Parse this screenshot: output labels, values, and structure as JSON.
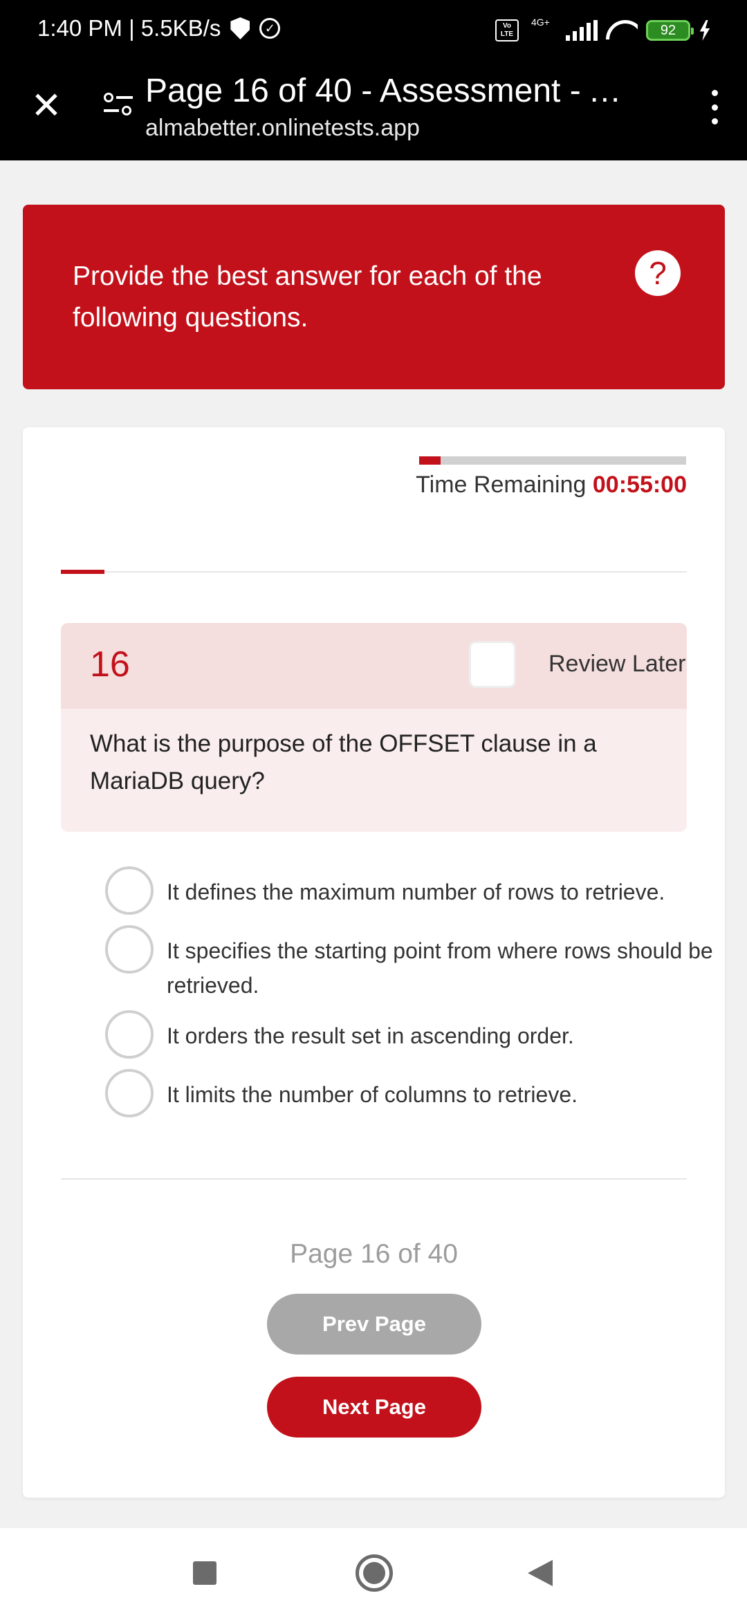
{
  "status_bar": {
    "time_speed": "1:40 PM | 5.5KB/s",
    "volte_label": "Vo\nLTE",
    "network_type": "4G+",
    "battery_level": "92"
  },
  "browser": {
    "title": "Page 16 of 40 - Assessment - Al...",
    "url": "almabetter.onlinetests.app",
    "close_glyph": "✕"
  },
  "banner": {
    "instruction": "Provide the best answer for each of the following questions.",
    "help_glyph": "?"
  },
  "timer": {
    "label": "Time Remaining",
    "value": "00:55:00",
    "elapsed_fraction": 0.08
  },
  "progress": {
    "fraction": 0.07
  },
  "question": {
    "number": "16",
    "review_label": "Review Later",
    "text": "What is the purpose of the OFFSET clause in a MariaDB query?",
    "options": [
      "It defines the maximum number of rows to retrieve.",
      "It specifies the starting point from where rows should be retrieved.",
      "It orders the result set in ascending order.",
      "It limits the number of columns to retrieve."
    ]
  },
  "pagination": {
    "page_text": "Page 16 of 40",
    "prev_label": "Prev Page",
    "next_label": "Next Page"
  },
  "colors": {
    "accent": "#c2111a",
    "question_header_bg": "#f5dede",
    "question_body_bg": "#f9eded",
    "disabled_button": "#a8a8a8"
  }
}
